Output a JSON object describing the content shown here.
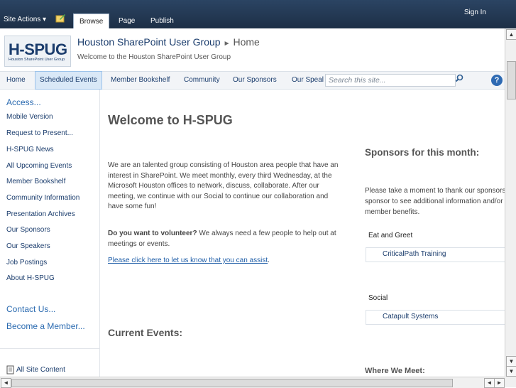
{
  "ribbon": {
    "site_actions": "Site Actions ▾",
    "tabs": [
      "Browse",
      "Page",
      "Publish"
    ],
    "sign_in": "Sign In"
  },
  "header": {
    "logo_text": "H-SPUG",
    "logo_subtext": "Houston SharePoint User Group",
    "site_title": "Houston SharePoint User Group",
    "page_title": "Home",
    "description": "Welcome to the Houston SharePoint User Group"
  },
  "topnav": {
    "items": [
      "Home",
      "Scheduled Events",
      "Member Bookshelf",
      "Community",
      "Our Sponsors",
      "Our Speal"
    ],
    "search_placeholder": "Search this site..."
  },
  "leftnav": {
    "access": "Access...",
    "items": [
      "Mobile Version",
      "Request to Present...",
      "H-SPUG News",
      "All Upcoming Events",
      "Member Bookshelf",
      "Community Information",
      "Presentation Archives",
      "Our Sponsors",
      "Our Speakers",
      "Job Postings",
      "About H-SPUG"
    ],
    "contact": "Contact Us...",
    "become_member": "Become a Member...",
    "all_site_content": "All Site Content"
  },
  "main": {
    "welcome_title": "Welcome to H-SPUG",
    "intro": "We are an talented group consisting of Houston area people that have an interest in SharePoint.  We meet monthly, every third Wednesday, at the Microsoft Houston offices to network, discuss, collaborate.  After our meeting, we continue with our Social to continue our collaboration and have some fun!",
    "volunteer_bold": "Do you want to volunteer?",
    "volunteer_text": " We always need a few people to help out at meetings or events.",
    "assist_link": "Please click here to let us know that you can assist",
    "assist_period": ".",
    "current_events": "Current Events:"
  },
  "sponsors": {
    "title": "Sponsors for this month:",
    "intro": "Please take a moment to thank our sponsors. Click on a sponsor to see additional information and/or H-SPUG member benefits.",
    "groups": [
      {
        "label": "Eat and Greet",
        "sponsor": "CriticalPath Training"
      },
      {
        "label": "Social",
        "sponsor": "Catapult Systems"
      }
    ],
    "where_we_meet": "Where We Meet:"
  },
  "colors": {
    "ribbon": "#1d2f46",
    "link": "#1b3d6d",
    "accent": "#2a6ab0"
  }
}
